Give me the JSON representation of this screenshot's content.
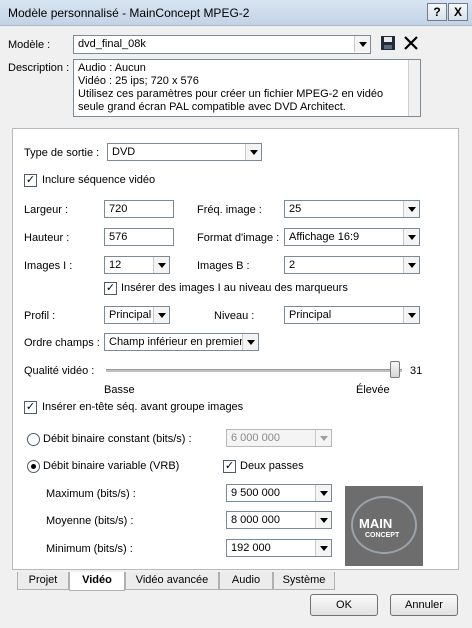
{
  "window": {
    "title": "Modèle personnalisé - MainConcept MPEG-2",
    "help_btn": "?",
    "close_btn": "X"
  },
  "template": {
    "label": "Modèle :",
    "value": "dvd_final_08k"
  },
  "description": {
    "label": "Description :",
    "lines": [
      "Audio : Aucun",
      "Vidéo : 25 ips; 720 x 576",
      "Utilisez ces paramètres pour créer un fichier MPEG-2 en vidéo",
      "seule grand écran PAL compatible avec DVD Architect."
    ]
  },
  "video": {
    "output_type_label": "Type de sortie :",
    "output_type_value": "DVD",
    "include_video_label": "Inclure séquence vidéo",
    "include_video_checked": "✓",
    "width_label": "Largeur :",
    "width_value": "720",
    "height_label": "Hauteur :",
    "height_value": "576",
    "iframes_label": "Images I :",
    "iframes_value": "12",
    "framerate_label": "Fréq. image :",
    "framerate_value": "25",
    "format_label": "Format d'image :",
    "format_value": "Affichage 16:9",
    "bframes_label": "Images B :",
    "bframes_value": "2",
    "insert_iframes_label": "Insérer des images I au niveau des marqueurs",
    "insert_iframes_checked": "✓",
    "profile_label": "Profil :",
    "profile_value": "Principal",
    "level_label": "Niveau :",
    "level_value": "Principal",
    "field_order_label": "Ordre champs :",
    "field_order_value": "Champ inférieur en premier",
    "quality_label": "Qualité vidéo :",
    "quality_value": "31",
    "quality_low": "Basse",
    "quality_high": "Élevée",
    "insert_header_label": "Insérer en-tête séq. avant groupe images",
    "insert_header_checked": "✓",
    "cbr_label": "Débit binaire constant (bits/s) :",
    "cbr_value": "6 000 000",
    "vbr_label": "Débit binaire variable (VRB)",
    "two_pass_label": "Deux passes",
    "two_pass_checked": "✓",
    "max_label": "Maximum (bits/s) :",
    "max_value": "9 500 000",
    "avg_label": "Moyenne (bits/s) :",
    "avg_value": "8 000 000",
    "min_label": "Minimum (bits/s) :",
    "min_value": "192 000"
  },
  "logo": {
    "main": "MAIN",
    "sub": "CONCEPT"
  },
  "tabs": [
    "Projet",
    "Vidéo",
    "Vidéo avancée",
    "Audio",
    "Système"
  ],
  "buttons": {
    "ok": "OK",
    "cancel": "Annuler"
  }
}
